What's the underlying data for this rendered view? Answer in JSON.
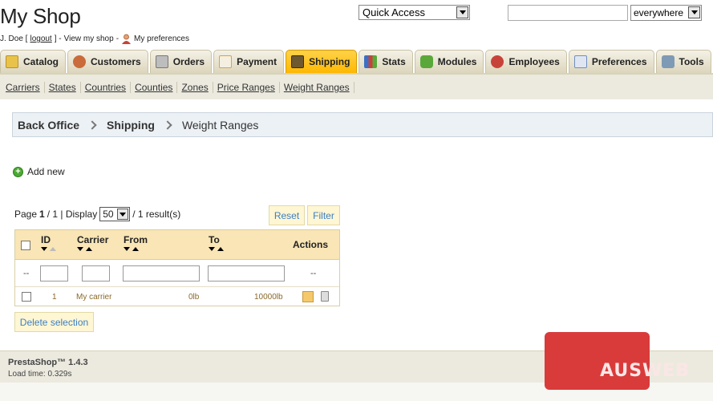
{
  "header": {
    "shop_title": "My Shop",
    "user": {
      "name": "J. Doe [",
      "logout": "logout",
      "close_bracket": "] -",
      "view_shop": "View my shop",
      "dash": "-",
      "preferences": "My preferences"
    },
    "quick_access": {
      "selected": "Quick Access"
    },
    "search": {
      "value": "",
      "scope": "everywhere"
    }
  },
  "tabs": [
    {
      "label": "Catalog",
      "icon": "folder-icon",
      "color": "#e9c24a"
    },
    {
      "label": "Customers",
      "icon": "customers-icon",
      "color": "#c96b3a"
    },
    {
      "label": "Orders",
      "icon": "cart-icon",
      "color": "#8d8d8d"
    },
    {
      "label": "Payment",
      "icon": "payment-icon",
      "color": "#d4a640"
    },
    {
      "label": "Shipping",
      "icon": "truck-icon",
      "color": "#6d5830"
    },
    {
      "label": "Stats",
      "icon": "stats-icon",
      "color": "#3d6fc4"
    },
    {
      "label": "Modules",
      "icon": "modules-icon",
      "color": "#5aa83a"
    },
    {
      "label": "Employees",
      "icon": "employees-icon",
      "color": "#c7433a"
    },
    {
      "label": "Preferences",
      "icon": "preferences-icon",
      "color": "#6f8fbf"
    },
    {
      "label": "Tools",
      "icon": "tools-icon",
      "color": "#7f9ab4"
    }
  ],
  "active_tab": "Shipping",
  "subnav": [
    "Carriers",
    "States",
    "Countries",
    "Counties",
    "Zones",
    "Price Ranges",
    "Weight Ranges"
  ],
  "breadcrumb": {
    "root": "Back Office",
    "section": "Shipping",
    "page": "Weight Ranges"
  },
  "add_new": "Add new",
  "pager": {
    "page_label": "Page",
    "page": "1",
    "total_pages": "/ 1 | Display",
    "display": "50",
    "results": "/ 1 result(s)"
  },
  "buttons": {
    "reset": "Reset",
    "filter": "Filter",
    "delete_selection": "Delete selection"
  },
  "table": {
    "columns": [
      "ID",
      "Carrier",
      "From",
      "To"
    ],
    "actions_label": "Actions",
    "filter_dash_left": "--",
    "filter_dash_right": "--",
    "rows": [
      {
        "id": "1",
        "carrier": "My carrier",
        "from": "0lb",
        "to": "10000lb"
      }
    ]
  },
  "footer": {
    "version": "PrestaShop™ 1.4.3",
    "load_time": "Load time: 0.329s"
  },
  "watermark": "AUSWEB"
}
